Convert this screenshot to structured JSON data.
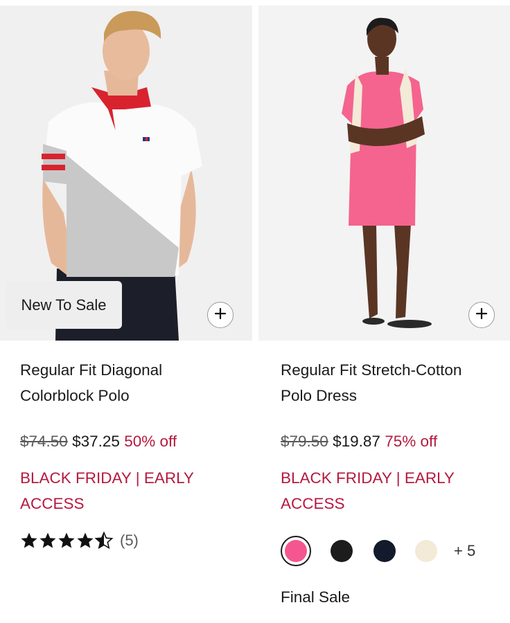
{
  "products": [
    {
      "badge": "New To Sale",
      "title_line1": "Regular Fit Diagonal",
      "title_line2": "Colorblock Polo",
      "original_price": "$74.50",
      "sale_price": "$37.25",
      "discount": "50% off",
      "promo_line1": "BLACK FRIDAY | EARLY",
      "promo_line2": "ACCESS",
      "rating": 4.5,
      "rating_count": "(5)"
    },
    {
      "title_line1": "Regular Fit Stretch-Cotton",
      "title_line2": "Polo Dress",
      "original_price": "$79.50",
      "sale_price": "$19.87",
      "discount": "75% off",
      "promo_line1": "BLACK FRIDAY | EARLY",
      "promo_line2": "ACCESS",
      "swatches": [
        {
          "color": "#f4578f",
          "selected": true
        },
        {
          "color": "#1c1c1c",
          "selected": false
        },
        {
          "color": "#121a2b",
          "selected": false
        },
        {
          "color": "#f3ead8",
          "selected": false
        }
      ],
      "more_colors": "+ 5",
      "final_sale": "Final Sale"
    }
  ],
  "colors": {
    "accent_red": "#b5193f",
    "text": "#1a1a1a",
    "badge_bg": "#eeeeee"
  },
  "icons": {
    "quick_add": "plus-icon",
    "rating": "star-icon"
  }
}
